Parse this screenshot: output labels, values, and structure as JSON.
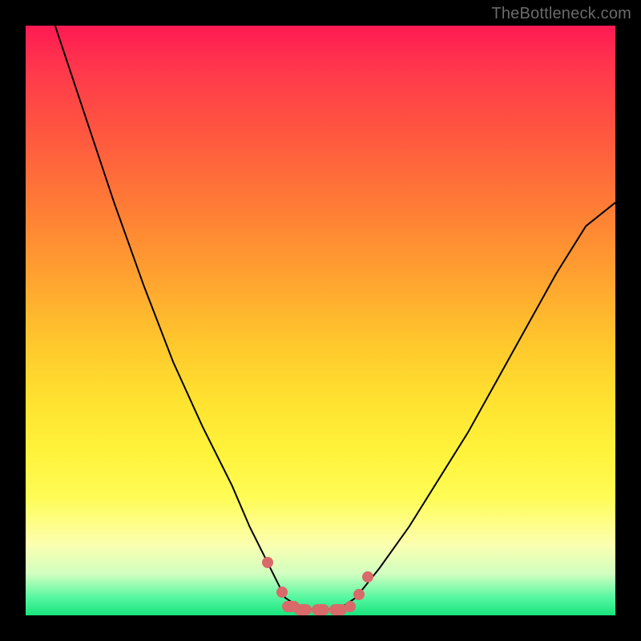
{
  "attribution": "TheBottleneck.com",
  "colors": {
    "frame": "#000000",
    "marker": "#d96a6a",
    "curve": "#000000"
  },
  "chart_data": {
    "type": "line",
    "title": "",
    "xlabel": "",
    "ylabel": "",
    "xlim": [
      0,
      100
    ],
    "ylim": [
      0,
      100
    ],
    "grid": false,
    "legend": false,
    "series": [
      {
        "name": "bottleneck-curve",
        "x": [
          5,
          10,
          15,
          20,
          25,
          30,
          35,
          38,
          41,
          44,
          47,
          50,
          53,
          56,
          60,
          65,
          70,
          75,
          80,
          85,
          90,
          95,
          100
        ],
        "y": [
          100,
          85,
          70,
          56,
          43,
          32,
          22,
          15,
          9,
          3,
          1,
          1,
          1,
          3,
          8,
          15,
          23,
          31,
          40,
          49,
          58,
          66,
          70
        ]
      }
    ],
    "markers": {
      "name": "optimal-range-dots",
      "x": [
        41,
        43.5,
        45,
        47,
        50,
        53,
        55,
        56.5,
        58
      ],
      "y": [
        9,
        4,
        1.5,
        1,
        1,
        1,
        1.5,
        3.5,
        6.5
      ]
    },
    "gradient_stops": [
      {
        "pos": 0,
        "color": "#ff1a53"
      },
      {
        "pos": 8,
        "color": "#ff3a4b"
      },
      {
        "pos": 18,
        "color": "#ff5640"
      },
      {
        "pos": 30,
        "color": "#ff7a36"
      },
      {
        "pos": 42,
        "color": "#ffa030"
      },
      {
        "pos": 54,
        "color": "#ffc82c"
      },
      {
        "pos": 64,
        "color": "#ffe330"
      },
      {
        "pos": 72,
        "color": "#fff23a"
      },
      {
        "pos": 80,
        "color": "#fffc55"
      },
      {
        "pos": 88,
        "color": "#fcffb0"
      },
      {
        "pos": 93,
        "color": "#d0ffc0"
      },
      {
        "pos": 97,
        "color": "#55f7a0"
      },
      {
        "pos": 100,
        "color": "#18e47d"
      }
    ]
  }
}
